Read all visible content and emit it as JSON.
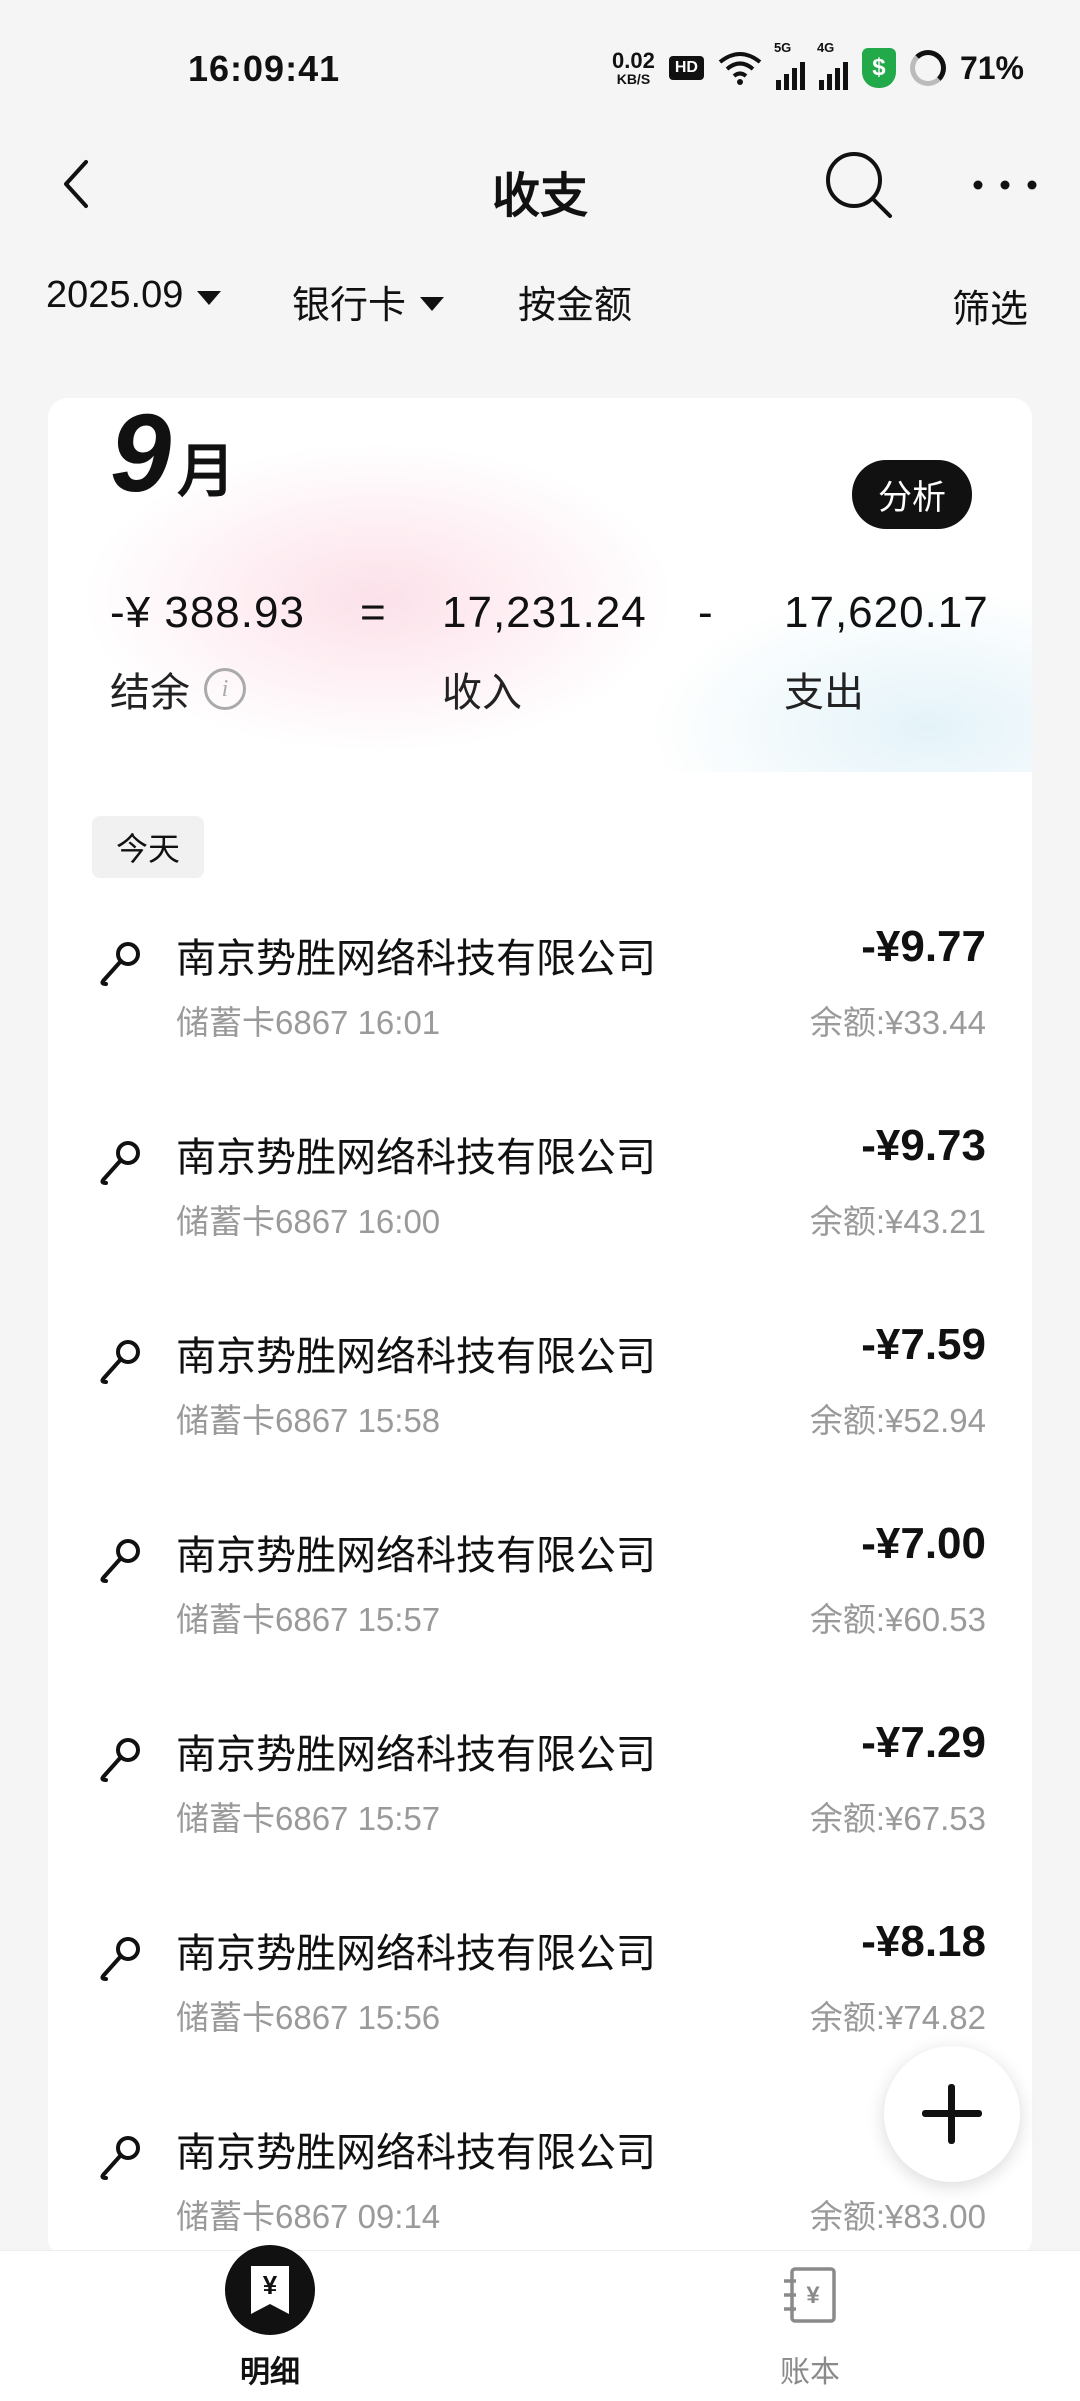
{
  "status_bar": {
    "time": "16:09:41",
    "speed_value": "0.02",
    "speed_unit": "KB/S",
    "hd": "HD",
    "net1": "5G",
    "net2": "4G",
    "battery": "71%"
  },
  "header": {
    "title": "收支"
  },
  "filters": {
    "month": "2025.09",
    "account": "银行卡",
    "sort": "按金额",
    "filter": "筛选"
  },
  "summary": {
    "month_number": "9",
    "month_unit": "月",
    "analyze_label": "分析",
    "balance": "-¥ 388.93",
    "balance_label": "结余",
    "equals": "=",
    "income": "17,231.24",
    "income_label": "收入",
    "minus": "-",
    "expense": "17,620.17",
    "expense_label": "支出"
  },
  "day_label": "今天",
  "transactions": [
    {
      "name": "南京势胜网络科技有限公司",
      "meta": "储蓄卡6867 16:01",
      "amount": "-¥9.77",
      "balance": "余额:¥33.44"
    },
    {
      "name": "南京势胜网络科技有限公司",
      "meta": "储蓄卡6867 16:00",
      "amount": "-¥9.73",
      "balance": "余额:¥43.21"
    },
    {
      "name": "南京势胜网络科技有限公司",
      "meta": "储蓄卡6867 15:58",
      "amount": "-¥7.59",
      "balance": "余额:¥52.94"
    },
    {
      "name": "南京势胜网络科技有限公司",
      "meta": "储蓄卡6867 15:57",
      "amount": "-¥7.00",
      "balance": "余额:¥60.53"
    },
    {
      "name": "南京势胜网络科技有限公司",
      "meta": "储蓄卡6867 15:57",
      "amount": "-¥7.29",
      "balance": "余额:¥67.53"
    },
    {
      "name": "南京势胜网络科技有限公司",
      "meta": "储蓄卡6867 15:56",
      "amount": "-¥8.18",
      "balance": "余额:¥74.82"
    },
    {
      "name": "南京势胜网络科技有限公司",
      "meta": "储蓄卡6867 09:14",
      "amount": "-¥",
      "balance": "余额:¥83.00"
    }
  ],
  "nav": {
    "details_label": "明细",
    "ledger_label": "账本",
    "yen": "¥"
  }
}
